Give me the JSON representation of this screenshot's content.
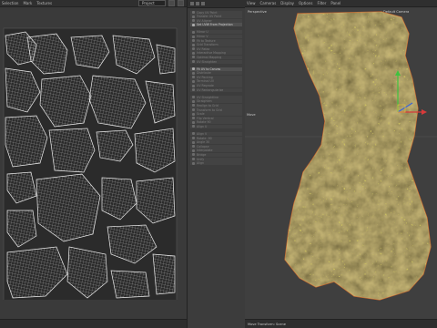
{
  "uv_editor": {
    "menu": [
      "Selection",
      "Mark",
      "Textures"
    ],
    "dropdown_value": "Project"
  },
  "uv_tools": {
    "items": [
      {
        "label": "Copy UV Point",
        "highlight": false
      },
      {
        "label": "Transfer UV Point",
        "highlight": false
      },
      {
        "label": "UV Aligner",
        "highlight": false
      },
      {
        "label": "Set UVW From Projection",
        "highlight": true
      },
      {
        "label": "Mirror U",
        "highlight": false
      },
      {
        "label": "Mirror V",
        "highlight": false
      },
      {
        "label": "Fit to Texture",
        "highlight": false
      },
      {
        "label": "Grid Transform",
        "highlight": false
      },
      {
        "label": "UV Relax",
        "highlight": false
      },
      {
        "label": "Interactive Mapping",
        "highlight": false
      },
      {
        "label": "Optimal Mapping",
        "highlight": false
      },
      {
        "label": "UV Straighten",
        "highlight": false
      },
      {
        "label": "Fit UV to Canvas",
        "highlight": true
      },
      {
        "label": "Distribute",
        "highlight": false
      },
      {
        "label": "UV Packing",
        "highlight": false
      },
      {
        "label": "Terminal UV",
        "highlight": false
      },
      {
        "label": "UV Regrade",
        "highlight": false
      },
      {
        "label": "UV Rectangularize",
        "highlight": false
      },
      {
        "label": "UV Straightline",
        "highlight": false
      },
      {
        "label": "Straighten",
        "highlight": false
      },
      {
        "label": "Realign to Grid",
        "highlight": false
      },
      {
        "label": "Transform to Grid",
        "highlight": false
      },
      {
        "label": "Scale",
        "highlight": false
      },
      {
        "label": "Flip Vertical",
        "highlight": false
      },
      {
        "label": "Rotate 90",
        "highlight": false
      },
      {
        "label": "Align U",
        "highlight": false
      },
      {
        "label": "Align V",
        "highlight": false
      },
      {
        "label": "Rotate -90",
        "highlight": false
      },
      {
        "label": "Angle 30",
        "highlight": false
      },
      {
        "label": "Collapse",
        "highlight": false
      },
      {
        "label": "Interpolate",
        "highlight": false
      },
      {
        "label": "Bridge",
        "highlight": false
      },
      {
        "label": "Unify",
        "highlight": false
      },
      {
        "label": "Align",
        "highlight": false
      }
    ]
  },
  "viewport": {
    "menu": [
      "View",
      "Cameras",
      "Display",
      "Options",
      "Filter",
      "Panel"
    ],
    "view_name": "Perspective",
    "camera": "Default Camera",
    "move_label": "Move",
    "status": "Move Transform: Scene"
  },
  "colors": {
    "mesh_fill": "#4b3f2a",
    "mesh_outline": "#c9672e",
    "uv_line": "#d8d8d8",
    "axis_y": "#3ec23e",
    "axis_x": "#d83a3a",
    "axis_z": "#3a64d8"
  }
}
